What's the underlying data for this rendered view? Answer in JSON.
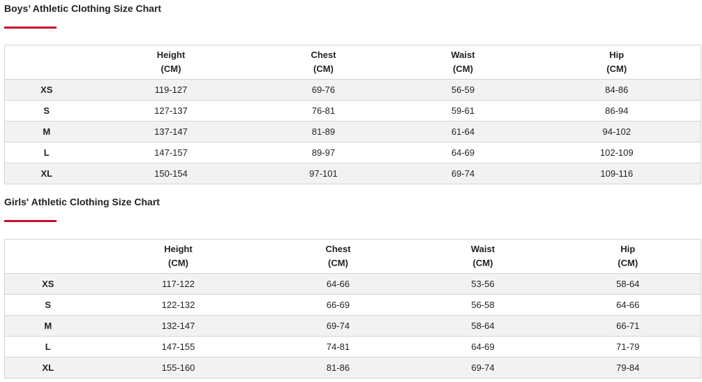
{
  "accent_color": "#c8102e",
  "charts": [
    {
      "title": "Boys’ Athletic Clothing Size Chart",
      "columns": [
        {
          "label": "",
          "unit": ""
        },
        {
          "label": "Height",
          "unit": "(CM)"
        },
        {
          "label": "Chest",
          "unit": "(CM)"
        },
        {
          "label": "Waist",
          "unit": "(CM)"
        },
        {
          "label": "Hip",
          "unit": "(CM)"
        }
      ],
      "rows": [
        {
          "size": "XS",
          "height": "119-127",
          "chest": "69-76",
          "waist": "56-59",
          "hip": "84-86"
        },
        {
          "size": "S",
          "height": "127-137",
          "chest": "76-81",
          "waist": "59-61",
          "hip": "86-94"
        },
        {
          "size": "M",
          "height": "137-147",
          "chest": "81-89",
          "waist": "61-64",
          "hip": "94-102"
        },
        {
          "size": "L",
          "height": "147-157",
          "chest": "89-97",
          "waist": "64-69",
          "hip": "102-109"
        },
        {
          "size": "XL",
          "height": "150-154",
          "chest": "97-101",
          "waist": "69-74",
          "hip": "109-116"
        }
      ]
    },
    {
      "title": "Girls' Athletic Clothing Size Chart",
      "columns": [
        {
          "label": "",
          "unit": ""
        },
        {
          "label": "Height",
          "unit": "(CM)"
        },
        {
          "label": "Chest",
          "unit": "(CM)"
        },
        {
          "label": "Waist",
          "unit": "(CM)"
        },
        {
          "label": "Hip",
          "unit": "(CM)"
        }
      ],
      "rows": [
        {
          "size": "XS",
          "height": "117-122",
          "chest": "64-66",
          "waist": "53-56",
          "hip": "58-64"
        },
        {
          "size": "S",
          "height": "122-132",
          "chest": "66-69",
          "waist": "56-58",
          "hip": "64-66"
        },
        {
          "size": "M",
          "height": "132-147",
          "chest": "69-74",
          "waist": "58-64",
          "hip": "66-71"
        },
        {
          "size": "L",
          "height": "147-155",
          "chest": "74-81",
          "waist": "64-69",
          "hip": "71-79"
        },
        {
          "size": "XL",
          "height": "155-160",
          "chest": "81-86",
          "waist": "69-74",
          "hip": "79-84"
        }
      ]
    }
  ]
}
